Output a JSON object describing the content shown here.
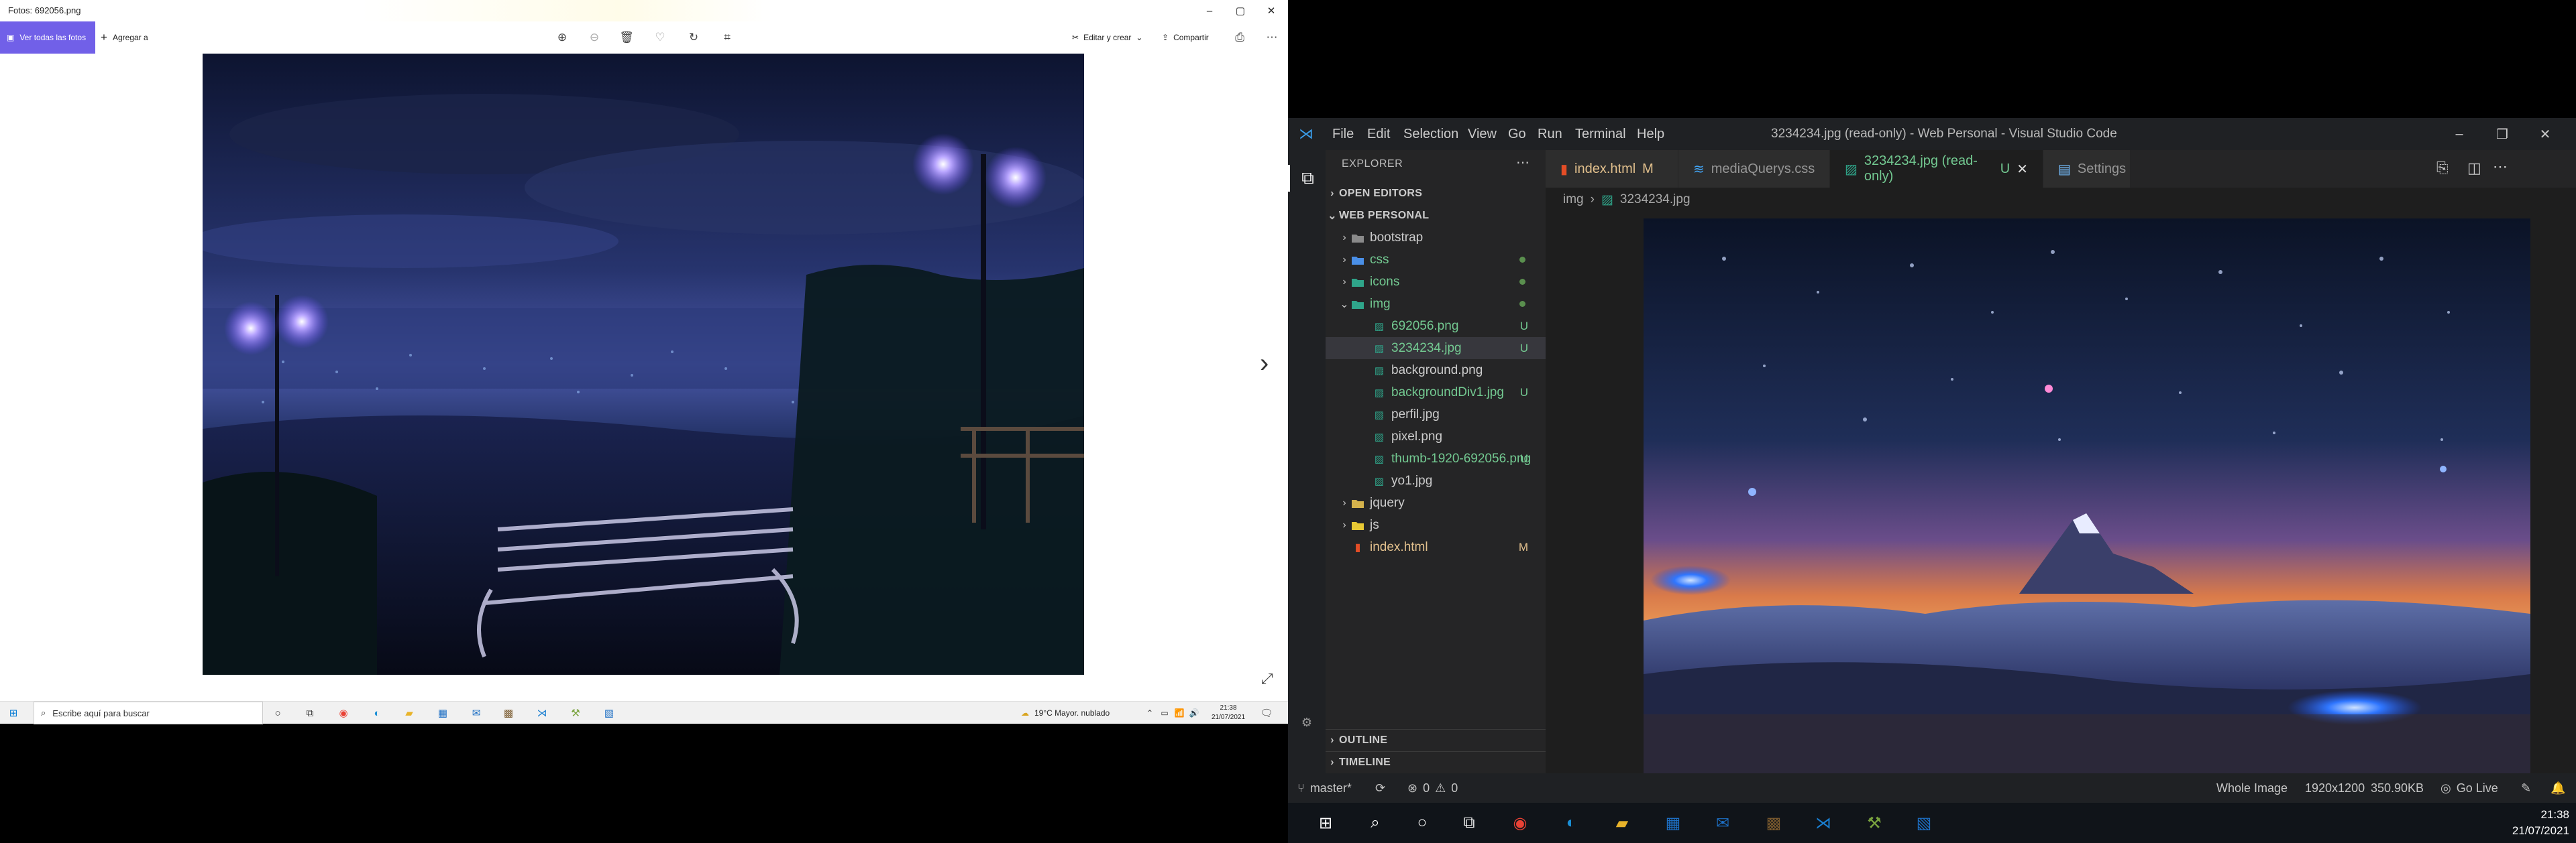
{
  "photos": {
    "title": "Fotos: 692056.png",
    "see_all": "Ver todas las fotos",
    "add_to": "Agregar a",
    "edit_create": "Editar y crear",
    "share": "Compartir"
  },
  "left_taskbar": {
    "search_placeholder": "Escribe aquí para buscar",
    "weather": "19°C  Mayor. nublado",
    "time": "21:38",
    "date": "21/07/2021"
  },
  "vscode": {
    "menu": [
      "File",
      "Edit",
      "Selection",
      "View",
      "Go",
      "Run",
      "Terminal",
      "Help"
    ],
    "window_title": "3234234.jpg (read-only) - Web Personal - Visual Studio Code",
    "explorer_title": "EXPLORER",
    "open_editors": "OPEN EDITORS",
    "workspace": "WEB PERSONAL",
    "tree": [
      {
        "label": "bootstrap",
        "badge": ""
      },
      {
        "label": "css",
        "badge": ""
      },
      {
        "label": "icons",
        "badge": ""
      },
      {
        "label": "img",
        "badge": ""
      },
      {
        "label": "692056.png",
        "badge": "U"
      },
      {
        "label": "3234234.jpg",
        "badge": "U"
      },
      {
        "label": "background.png",
        "badge": ""
      },
      {
        "label": "backgroundDiv1.jpg",
        "badge": "U"
      },
      {
        "label": "perfil.jpg",
        "badge": ""
      },
      {
        "label": "pixel.png",
        "badge": ""
      },
      {
        "label": "thumb-1920-692056.png",
        "badge": "U"
      },
      {
        "label": "yo1.jpg",
        "badge": ""
      },
      {
        "label": "jquery",
        "badge": ""
      },
      {
        "label": "js",
        "badge": ""
      },
      {
        "label": "index.html",
        "badge": "M"
      }
    ],
    "outline": "OUTLINE",
    "timeline": "TIMELINE",
    "tabs": [
      {
        "label": "index.html",
        "badge": "M"
      },
      {
        "label": "mediaQuerys.css",
        "badge": ""
      },
      {
        "label": "3234234.jpg (read-only)",
        "badge": "U"
      },
      {
        "label": "Settings",
        "badge": ""
      }
    ],
    "breadcrumb": {
      "folder": "img",
      "file": "3234234.jpg"
    },
    "status": {
      "branch": "master*",
      "errors": "0",
      "warnings": "0",
      "zoom": "Whole Image",
      "dimensions": "1920x1200",
      "size": "350.90KB",
      "golive": "Go Live"
    }
  },
  "right_taskbar": {
    "time": "21:38",
    "date": "21/07/2021"
  }
}
